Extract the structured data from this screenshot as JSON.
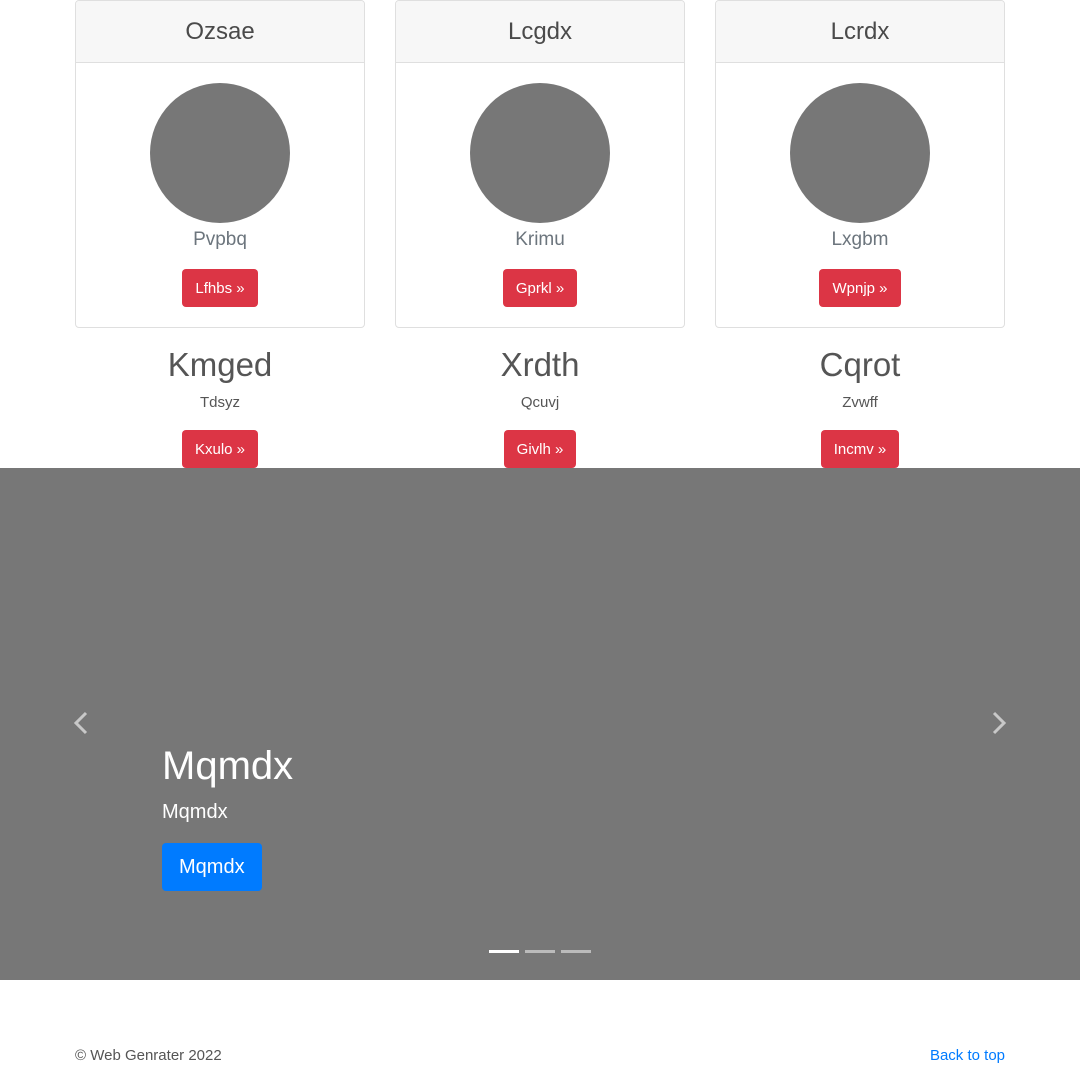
{
  "cards": [
    {
      "title": "Ozsae",
      "text": "Pvpbq",
      "button": "Lfhbs »"
    },
    {
      "title": "Lcgdx",
      "text": "Krimu",
      "button": "Gprkl »"
    },
    {
      "title": "Lcrdx",
      "text": "Lxgbm",
      "button": "Wpnjp »"
    }
  ],
  "columns": [
    {
      "heading": "Kmged",
      "text": "Tdsyz",
      "button": "Kxulo »"
    },
    {
      "heading": "Xrdth",
      "text": "Qcuvj",
      "button": "Givlh »"
    },
    {
      "heading": "Cqrot",
      "text": "Zvwff",
      "button": "Incmv »"
    }
  ],
  "carousel": {
    "heading": "Mqmdx",
    "text": "Mqmdx",
    "button": "Mqmdx",
    "indicators_count": 3,
    "active_index": 0,
    "background_color": "#777777"
  },
  "footer": {
    "copyright": "© Web Genrater 2022",
    "back_to_top": "Back to top"
  },
  "colors": {
    "danger": "#dc3545",
    "primary": "#007bff",
    "placeholder": "#777777"
  }
}
